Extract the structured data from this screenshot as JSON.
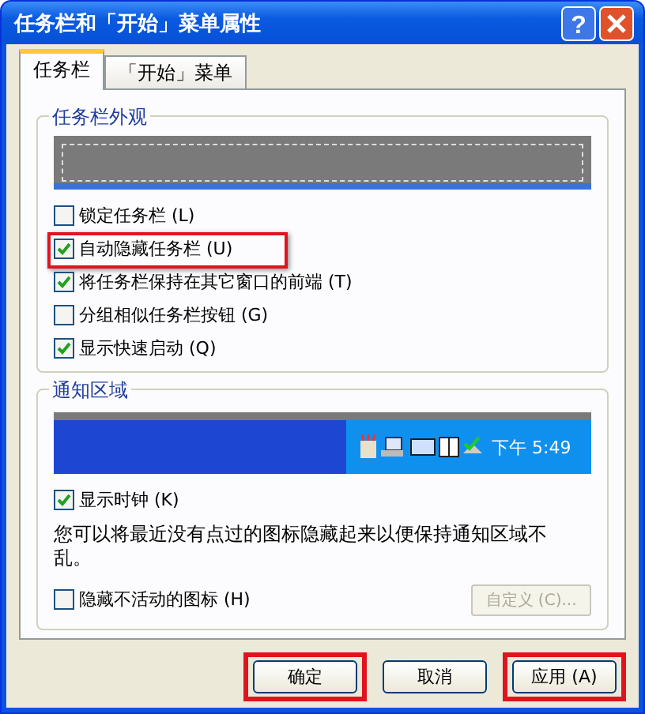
{
  "window": {
    "title": "任务栏和「开始」菜单属性",
    "help": "?"
  },
  "tabs": [
    {
      "label": "任务栏",
      "selected": true
    },
    {
      "label": "「开始」菜单",
      "selected": false
    }
  ],
  "appearance": {
    "title": "任务栏外观",
    "options": [
      {
        "label": "锁定任务栏 (L)",
        "checked": false,
        "highlighted": false
      },
      {
        "label": "自动隐藏任务栏 (U)",
        "checked": true,
        "highlighted": true
      },
      {
        "label": "将任务栏保持在其它窗口的前端 (T)",
        "checked": true,
        "highlighted": false
      },
      {
        "label": "分组相似任务栏按钮 (G)",
        "checked": false,
        "highlighted": false
      },
      {
        "label": "显示快速启动 (Q)",
        "checked": true,
        "highlighted": false
      }
    ]
  },
  "notification": {
    "title": "通知区域",
    "clock": "下午 5:49",
    "show_clock": {
      "label": "显示时钟 (K)",
      "checked": true
    },
    "description": "您可以将最近没有点过的图标隐藏起来以便保持通知区域不乱。",
    "hide_inactive": {
      "label": "隐藏不活动的图标 (H)",
      "checked": false
    },
    "customize": {
      "label": "自定义 (C)...",
      "disabled": true
    }
  },
  "buttons": [
    {
      "label": "确定",
      "highlighted": true
    },
    {
      "label": "取消",
      "highlighted": false
    },
    {
      "label": "应用 (A)",
      "highlighted": true
    }
  ]
}
